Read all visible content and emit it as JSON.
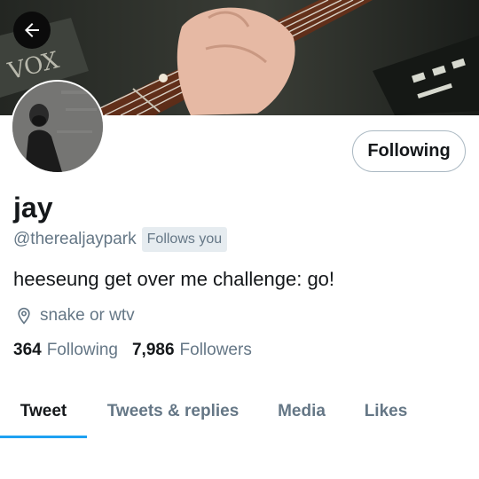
{
  "header": {
    "back_icon": "arrow-left-icon",
    "banner_text": "VOX"
  },
  "profile": {
    "name": "jay",
    "handle": "@therealjaypark",
    "follows_you_badge": "Follows you",
    "follow_button_label": "Following",
    "bio": "heeseung get over me challenge: go!",
    "location_icon": "location-pin-icon",
    "location": "snake or wtv"
  },
  "stats": {
    "following_count": "364",
    "following_label": "Following",
    "followers_count": "7,986",
    "followers_label": "Followers"
  },
  "tabs": [
    {
      "label": "Tweet",
      "active": true
    },
    {
      "label": "Tweets & replies",
      "active": false
    },
    {
      "label": "Media",
      "active": false
    },
    {
      "label": "Likes",
      "active": false
    }
  ],
  "colors": {
    "accent": "#1da1f2",
    "secondary_text": "#657786",
    "primary_text": "#14171a"
  }
}
